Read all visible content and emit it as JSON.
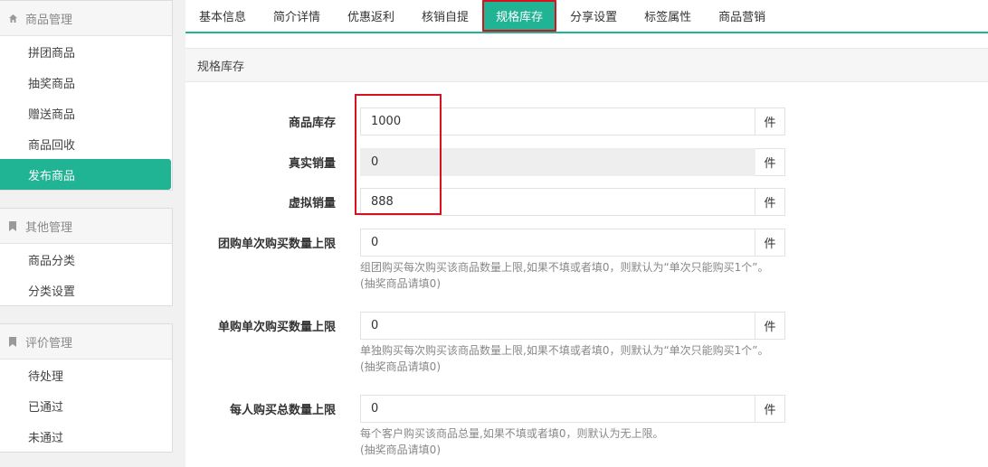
{
  "sidebar": {
    "groups": [
      {
        "title": "商品管理",
        "icon": "home-icon",
        "items": [
          "拼团商品",
          "抽奖商品",
          "赠送商品",
          "商品回收",
          "发布商品"
        ],
        "active": 4
      },
      {
        "title": "其他管理",
        "icon": "bookmark-icon",
        "items": [
          "商品分类",
          "分类设置"
        ]
      },
      {
        "title": "评价管理",
        "icon": "bookmark-icon",
        "items": [
          "待处理",
          "已通过",
          "未通过"
        ]
      }
    ]
  },
  "tabs": [
    "基本信息",
    "简介详情",
    "优惠返利",
    "核销自提",
    "规格库存",
    "分享设置",
    "标签属性",
    "商品营销"
  ],
  "active_tab": "规格库存",
  "panel": {
    "title": "规格库存",
    "fields": [
      {
        "label": "商品库存",
        "value": "1000",
        "unit": "件"
      },
      {
        "label": "真实销量",
        "value": "0",
        "unit": "件",
        "readonly": true
      },
      {
        "label": "虚拟销量",
        "value": "888",
        "unit": "件"
      },
      {
        "label": "团购单次购买数量上限",
        "value": "0",
        "unit": "件",
        "help1": "组团购买每次购买该商品数量上限,如果不填或者填0，则默认为“单次只能购买1个”。",
        "help2": "(抽奖商品请填0)"
      },
      {
        "label": "单购单次购买数量上限",
        "value": "0",
        "unit": "件",
        "help1": "单独购买每次购买该商品数量上限,如果不填或者填0，则默认为“单次只能购买1个”。",
        "help2": "(抽奖商品请填0)"
      },
      {
        "label": "每人购买总数量上限",
        "value": "0",
        "unit": "件",
        "help1": "每个客户购买该商品总量,如果不填或者填0，则默认为无上限。",
        "help2": "(抽奖商品请填0)"
      }
    ]
  },
  "colors": {
    "accent": "#20b394",
    "highlight": "#d9101d"
  }
}
